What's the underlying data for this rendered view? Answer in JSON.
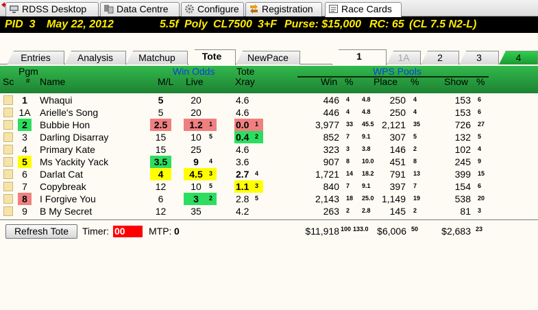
{
  "window_tabs": [
    {
      "label": "RDSS Desktop",
      "icon": "desktop-icon"
    },
    {
      "label": "Data Centre",
      "icon": "database-icon"
    },
    {
      "label": "Configure",
      "icon": "gear-icon"
    },
    {
      "label": "Registration",
      "icon": "registration-icon"
    },
    {
      "label": "Race Cards",
      "icon": "race-card-icon"
    }
  ],
  "race_info": {
    "pid": "PID  3",
    "date": "May 22, 2012",
    "distance": "5.5f",
    "surface": "Poly",
    "class": "CL7500",
    "age_sex": "3+F",
    "purse": "Purse: $15,000",
    "rc": "RC: 65",
    "cl": "(CL 7.5 N2-L)"
  },
  "sub_tabs": [
    "Entries",
    "Analysis",
    "Matchup",
    "Tote",
    "NewPace"
  ],
  "race_tabs": [
    "1",
    "1A",
    "2",
    "3",
    "4"
  ],
  "headers": {
    "pgm": "Pgm",
    "sc": "Sc",
    "num": "#",
    "name": "Name",
    "win_odds": "Win Odds",
    "ml": "M/L",
    "live": "Live",
    "tote": "Tote",
    "xray": "Xray",
    "wps_pools": "WPS Pools",
    "win": "Win",
    "pct1": "%",
    "place": "Place",
    "pct2": "%",
    "show": "Show",
    "pct3": "%"
  },
  "colors": {
    "red": "#f08080",
    "green": "#2ddd5f",
    "yellow": "#ffff00"
  },
  "rows": [
    {
      "pgm": "1",
      "name": "Whaqui",
      "ml": "5",
      "live": "20",
      "live_rank": "",
      "xray": "4.6",
      "xray_rank": "",
      "win": "446",
      "win_pct": "4",
      "win_x": "4.8",
      "place": "250",
      "place_pct": "4",
      "show": "153",
      "show_pct": "6"
    },
    {
      "pgm": "1A",
      "name": "Arielle's Song",
      "ml": "5",
      "live": "20",
      "live_rank": "",
      "xray": "4.6",
      "xray_rank": "",
      "win": "446",
      "win_pct": "4",
      "win_x": "4.8",
      "place": "250",
      "place_pct": "4",
      "show": "153",
      "show_pct": "6"
    },
    {
      "pgm": "2",
      "name": "Bubbie Hon",
      "ml": "2.5",
      "live": "1.2",
      "live_rank": "1",
      "xray": "0.0",
      "xray_rank": "1",
      "win": "3,977",
      "win_pct": "33",
      "win_x": "45.5",
      "place": "2,121",
      "place_pct": "35",
      "show": "726",
      "show_pct": "27"
    },
    {
      "pgm": "3",
      "name": "Darling Disarray",
      "ml": "15",
      "live": "10",
      "live_rank": "5",
      "xray": "0.4",
      "xray_rank": "2",
      "win": "852",
      "win_pct": "7",
      "win_x": "9.1",
      "place": "307",
      "place_pct": "5",
      "show": "132",
      "show_pct": "5"
    },
    {
      "pgm": "4",
      "name": "Primary Kate",
      "ml": "15",
      "live": "25",
      "live_rank": "",
      "xray": "4.6",
      "xray_rank": "",
      "win": "323",
      "win_pct": "3",
      "win_x": "3.8",
      "place": "146",
      "place_pct": "2",
      "show": "102",
      "show_pct": "4"
    },
    {
      "pgm": "5",
      "name": "Ms Yackity Yack",
      "ml": "3.5",
      "live": "9",
      "live_rank": "4",
      "xray": "3.6",
      "xray_rank": "",
      "win": "907",
      "win_pct": "8",
      "win_x": "10.0",
      "place": "451",
      "place_pct": "8",
      "show": "245",
      "show_pct": "9"
    },
    {
      "pgm": "6",
      "name": "Darlat Cat",
      "ml": "4",
      "live": "4.5",
      "live_rank": "3",
      "xray": "2.7",
      "xray_rank": "4",
      "win": "1,721",
      "win_pct": "14",
      "win_x": "18.2",
      "place": "791",
      "place_pct": "13",
      "show": "399",
      "show_pct": "15"
    },
    {
      "pgm": "7",
      "name": "Copybreak",
      "ml": "12",
      "live": "10",
      "live_rank": "5",
      "xray": "1.1",
      "xray_rank": "3",
      "win": "840",
      "win_pct": "7",
      "win_x": "9.1",
      "place": "397",
      "place_pct": "7",
      "show": "154",
      "show_pct": "6"
    },
    {
      "pgm": "8",
      "name": "I Forgive You",
      "ml": "6",
      "live": "3",
      "live_rank": "2",
      "xray": "2.8",
      "xray_rank": "5",
      "win": "2,143",
      "win_pct": "18",
      "win_x": "25.0",
      "place": "1,149",
      "place_pct": "19",
      "show": "538",
      "show_pct": "20"
    },
    {
      "pgm": "9",
      "name": "B My Secret",
      "ml": "12",
      "live": "35",
      "live_rank": "",
      "xray": "4.2",
      "xray_rank": "",
      "win": "263",
      "win_pct": "2",
      "win_x": "2.8",
      "place": "145",
      "place_pct": "2",
      "show": "81",
      "show_pct": "3"
    }
  ],
  "totals": {
    "win": "$11,918",
    "win_pct": "100",
    "win_x": "133.0",
    "place": "$6,006",
    "place_pct": "50",
    "show": "$2,683",
    "show_pct": "23"
  },
  "footer": {
    "refresh_label": "Refresh Tote",
    "timer_label": "Timer:",
    "timer_value": "00",
    "mtp_label": "MTP:",
    "mtp_value": "0"
  }
}
